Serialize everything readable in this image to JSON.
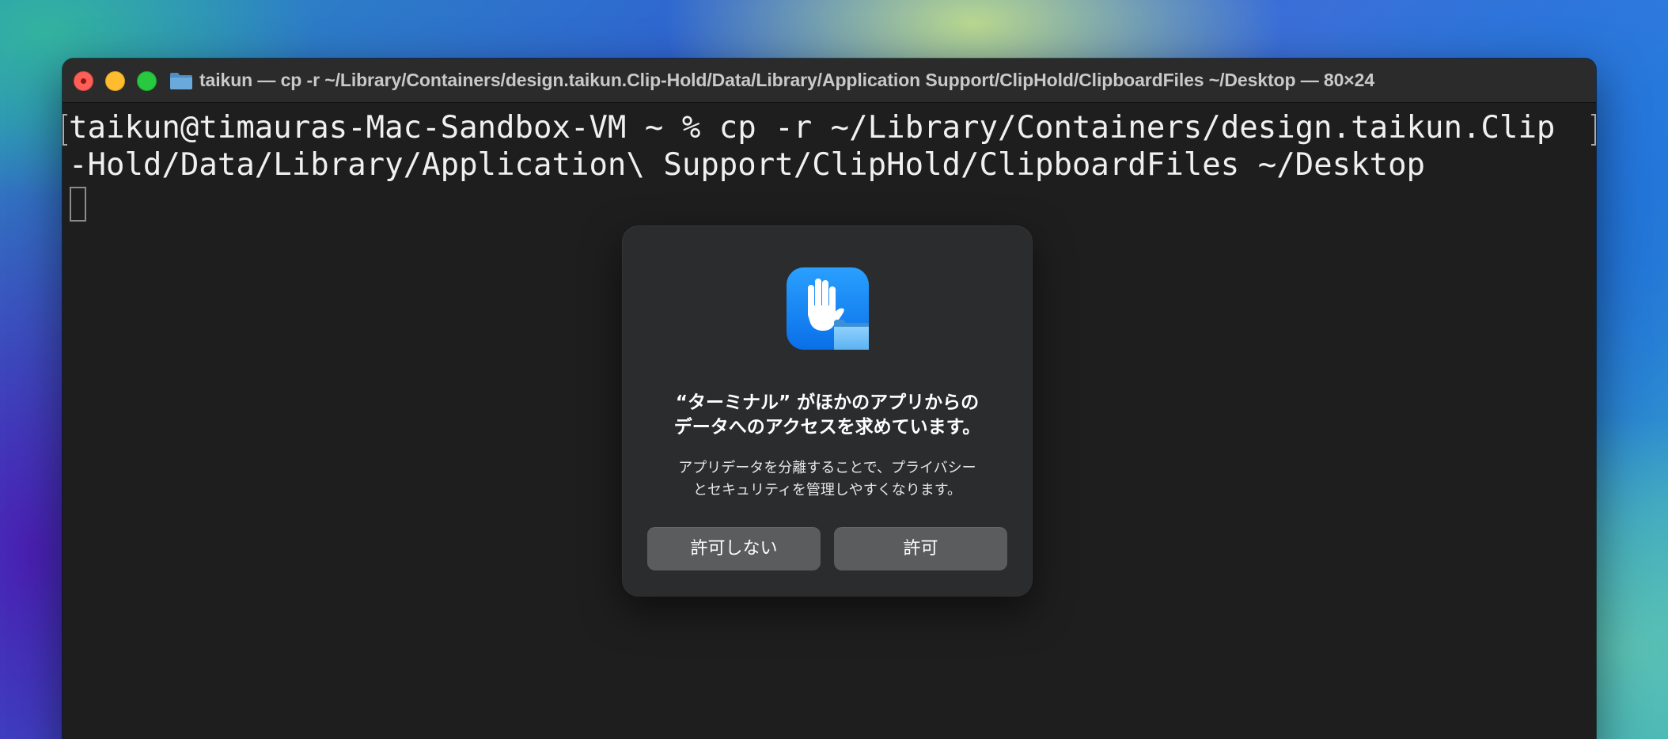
{
  "window": {
    "title": "taikun — cp -r ~/Library/Containers/design.taikun.Clip-Hold/Data/Library/Application Support/ClipHold/ClipboardFiles ~/Desktop — 80×24"
  },
  "terminal": {
    "line1": "taikun@timauras-Mac-Sandbox-VM ~ % cp -r ~/Library/Containers/design.taikun.Clip",
    "line2": "-Hold/Data/Library/Application\\ Support/ClipHold/ClipboardFiles ~/Desktop"
  },
  "dialog": {
    "title_line1": "“ターミナル” がほかのアプリからの",
    "title_line2": "データへのアクセスを求めています。",
    "body_line1": "アプリデータを分離することで、プライバシー",
    "body_line2": "とセキュリティを管理しやすくなります。",
    "deny_label": "許可しない",
    "allow_label": "許可"
  },
  "icons": {
    "privacy": "hand-folder-icon",
    "title_folder": "folder-icon"
  },
  "colors": {
    "terminal_bg": "#1e1e1e",
    "dialog_bg": "#2a2c2e",
    "button_bg": "#5a5c5e",
    "close": "#fe5f57",
    "minimize": "#febc2e",
    "zoom": "#28c840",
    "icon_blue": "#1a7cf5"
  }
}
